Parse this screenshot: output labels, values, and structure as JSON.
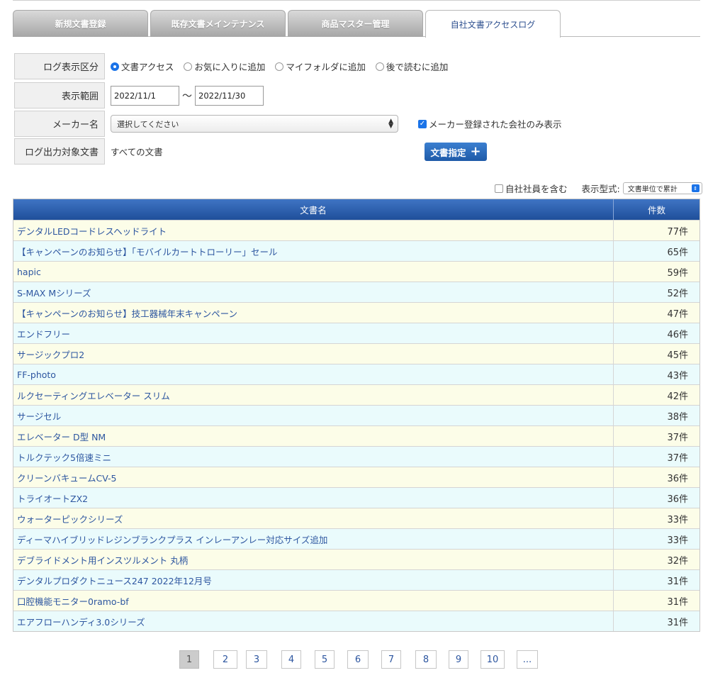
{
  "tabs": [
    {
      "label": "新規文書登録"
    },
    {
      "label": "既存文書メインテナンス"
    },
    {
      "label": "商品マスター管理"
    },
    {
      "label": "自社文書アクセスログ"
    }
  ],
  "form": {
    "log_type": {
      "label": "ログ表示区分",
      "options": [
        "文書アクセス",
        "お気に入りに追加",
        "マイフォルダに追加",
        "後で読むに追加"
      ],
      "selected": "文書アクセス"
    },
    "range": {
      "label": "表示範囲",
      "from": "2022/11/1",
      "tilde": "〜",
      "to": "2022/11/30"
    },
    "maker": {
      "label": "メーカー名",
      "select_value": "選択してください",
      "registered_only_label": "メーカー登録された会社のみ表示",
      "registered_only_checked": true
    },
    "target": {
      "label": "ログ出力対象文書",
      "value": "すべての文書",
      "button_label": "文書指定"
    }
  },
  "options": {
    "include_employees_label": "自社社員を含む",
    "include_employees_checked": false,
    "display_type_label": "表示型式:",
    "display_type_value": "文書単位で累計"
  },
  "table": {
    "headers": {
      "name": "文書名",
      "count": "件数"
    },
    "rows": [
      {
        "name": "デンタルLEDコードレスヘッドライト",
        "count": "77件"
      },
      {
        "name": "【キャンペーンのお知らせ】「モバイルカートトローリー」セール",
        "count": "65件"
      },
      {
        "name": "hapic",
        "count": "59件"
      },
      {
        "name": "S-MAX Mシリーズ",
        "count": "52件"
      },
      {
        "name": "【キャンペーンのお知らせ】技工器械年末キャンペーン",
        "count": "47件"
      },
      {
        "name": "エンドフリー",
        "count": "46件"
      },
      {
        "name": "サージックプロ2",
        "count": "45件"
      },
      {
        "name": "FF-photo",
        "count": "43件"
      },
      {
        "name": "ルクセーティングエレベーター スリム",
        "count": "42件"
      },
      {
        "name": "サージセル",
        "count": "38件"
      },
      {
        "name": "エレベーター D型 NM",
        "count": "37件"
      },
      {
        "name": "トルクテック5倍速ミニ",
        "count": "37件"
      },
      {
        "name": "クリーンバキュームCV-5",
        "count": "36件"
      },
      {
        "name": "トライオートZX2",
        "count": "36件"
      },
      {
        "name": "ウォーターピックシリーズ",
        "count": "33件"
      },
      {
        "name": "ディーマハイブリッドレジンブランクプラス インレーアンレー対応サイズ追加",
        "count": "33件"
      },
      {
        "name": "デブライドメント用インスツルメント 丸柄",
        "count": "32件"
      },
      {
        "name": "デンタルプロダクトニュース247 2022年12月号",
        "count": "31件"
      },
      {
        "name": "口腔機能モニター0ramo-bf",
        "count": "31件"
      },
      {
        "name": "エアフローハンディ3.0シリーズ",
        "count": "31件"
      }
    ]
  },
  "pagination": {
    "pages": [
      "1",
      "2",
      "3",
      "4",
      "5",
      "6",
      "7",
      "8",
      "9",
      "10",
      "..."
    ],
    "current": "1"
  }
}
